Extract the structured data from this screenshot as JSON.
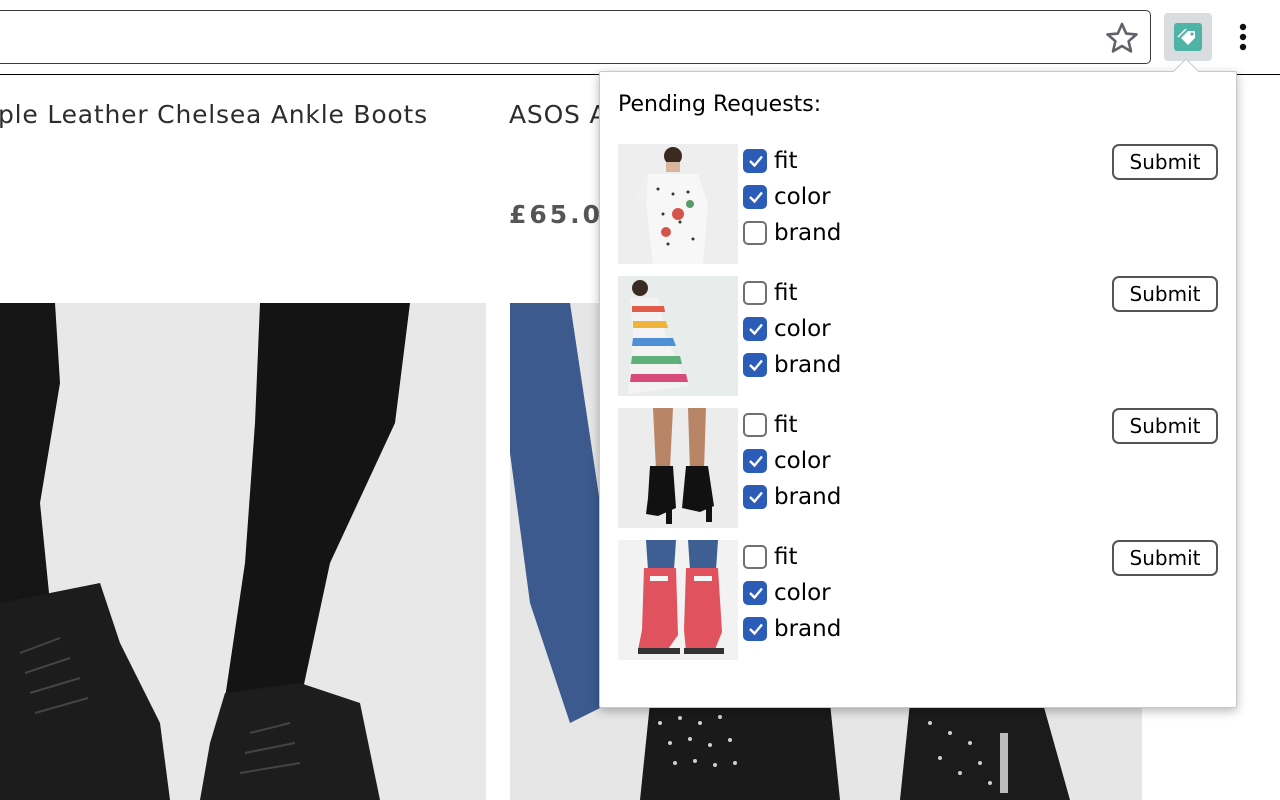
{
  "browser": {
    "star_icon": "star-outline-icon",
    "extension_icon": "price-tag-icon",
    "menu_icon": "vertical-dots-icon",
    "extension_color": "#4fb3a6"
  },
  "page": {
    "product_left_title": "ple Leather Chelsea Ankle Boots",
    "product_right_title": "ASOS A",
    "product_right_price": "£65.0"
  },
  "popup": {
    "title": "Pending Requests:",
    "submit_label": "Submit",
    "check_color": "#2b5cb8",
    "requests": [
      {
        "thumbnail": "polka-dot-ruffle-dress",
        "options": [
          {
            "label": "fit",
            "checked": true
          },
          {
            "label": "color",
            "checked": true
          },
          {
            "label": "brand",
            "checked": false
          }
        ]
      },
      {
        "thumbnail": "striped-maxi-dress",
        "options": [
          {
            "label": "fit",
            "checked": false
          },
          {
            "label": "color",
            "checked": true
          },
          {
            "label": "brand",
            "checked": true
          }
        ]
      },
      {
        "thumbnail": "black-sock-boots",
        "options": [
          {
            "label": "fit",
            "checked": false
          },
          {
            "label": "color",
            "checked": true
          },
          {
            "label": "brand",
            "checked": true
          }
        ]
      },
      {
        "thumbnail": "red-wellington-boots",
        "options": [
          {
            "label": "fit",
            "checked": false
          },
          {
            "label": "color",
            "checked": true
          },
          {
            "label": "brand",
            "checked": true
          }
        ]
      }
    ]
  }
}
